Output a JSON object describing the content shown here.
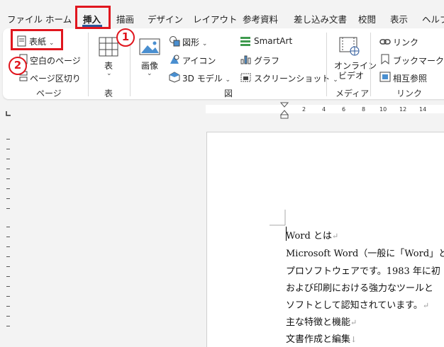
{
  "tabs": {
    "file": "ファイル",
    "home": "ホーム",
    "insert": "挿入",
    "draw": "描画",
    "design": "デザイン",
    "layout": "レイアウト",
    "references": "参考資料",
    "mailings": "差し込み文書",
    "review": "校閲",
    "view": "表示",
    "help": "ヘルプ"
  },
  "markers": {
    "one": "1",
    "two": "2"
  },
  "ribbon": {
    "pages": {
      "cover": "表紙",
      "blank": "空白のページ",
      "page_break": "ページ区切り",
      "group": "ページ"
    },
    "tables": {
      "table": "表",
      "group": "表"
    },
    "illustrations": {
      "pictures": "画像",
      "shapes": "図形",
      "icons": "アイコン",
      "models_3d": "3D モデル",
      "smartart": "SmartArt",
      "chart": "グラフ",
      "screenshot": "スクリーンショット",
      "group": "図"
    },
    "media": {
      "online_video_1": "オンライン",
      "online_video_2": "ビデオ",
      "group": "メディア"
    },
    "links": {
      "link": "リンク",
      "bookmark": "ブックマーク",
      "cross_reference": "相互参照",
      "group": "リンク"
    }
  },
  "ruler": {
    "ticks": [
      "2",
      "4",
      "6",
      "8",
      "10",
      "12",
      "14"
    ]
  },
  "document": {
    "lines": [
      "Word とは",
      "Microsoft Word（一般に「Word」と",
      "プロソフトウェアです。1983 年に初",
      "および印刷における強力なツールと",
      "ソフトとして認知されています。",
      "主な特徴と機能",
      "文書作成と編集"
    ],
    "mark_return": "↵",
    "mark_break": "↓"
  },
  "colors": {
    "accent": "#2b579a",
    "highlight": "#e0161e"
  }
}
